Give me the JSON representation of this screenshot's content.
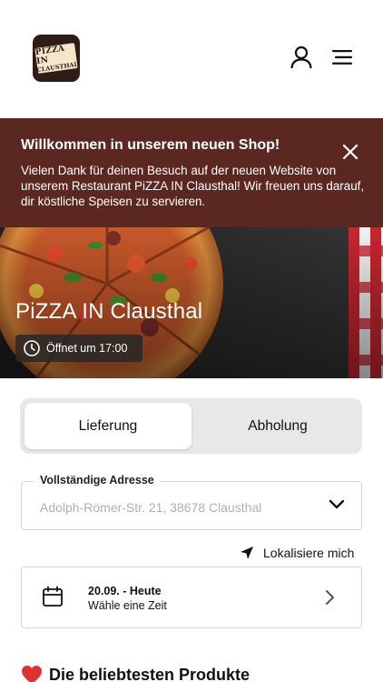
{
  "header": {
    "logo_line1": "PIZZA IN",
    "logo_line2": "CLAUSTHAL",
    "icons": {
      "account": "user-icon",
      "menu": "hamburger-menu-icon"
    }
  },
  "banner": {
    "title": "Willkommen in unserem neuen Shop!",
    "text": "Vielen Dank für deinen Besuch auf der neuen Website von unserem Restaurant PiZZA IN Clausthal! Wir freuen uns darauf, dir köstliche Speisen zu servieren.",
    "background": "#5a2721",
    "close_icon": "close-icon"
  },
  "hero": {
    "title": "PiZZA IN Clausthal",
    "opening": "Öffnet um 17:00",
    "clock_icon": "clock-icon"
  },
  "order_mode": {
    "options": [
      "Lieferung",
      "Abholung"
    ],
    "selected": "Lieferung"
  },
  "address": {
    "label": "Vollständige Adresse",
    "placeholder": "Adolph-Römer-Str. 21, 38678 Clausthal"
  },
  "locate": {
    "label": "Lokalisiere mich",
    "icon": "location-arrow-icon"
  },
  "time": {
    "title": "20.09. - Heute",
    "subtitle": "Wähle eine Zeit",
    "icon": "calendar-icon"
  },
  "section": {
    "title": "Die beliebtesten Produkte",
    "icon": "heart-icon"
  }
}
